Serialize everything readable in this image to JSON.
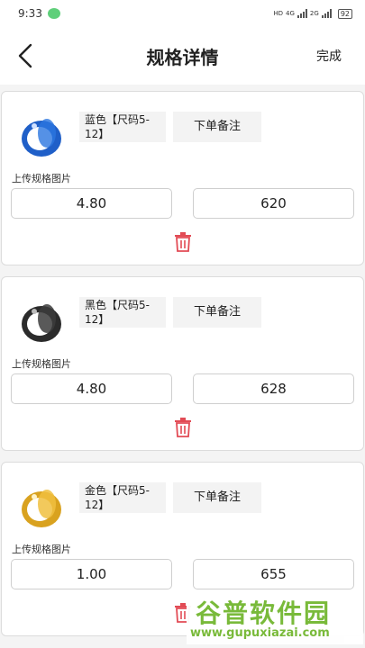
{
  "status_bar": {
    "time": "9:33",
    "net_left": "HD",
    "net_4g": "4G",
    "net_2g": "2G",
    "battery": "92"
  },
  "header": {
    "title": "规格详情",
    "done_label": "完成"
  },
  "items": [
    {
      "spec_name": "蓝色【尺码5-12】",
      "note_label": "下单备注",
      "upload_label": "上传规格图片",
      "price": "4.80",
      "stock": "620",
      "ring_color": "#1f5fc8",
      "ring_icon": "blue-ring-image"
    },
    {
      "spec_name": "黑色【尺码5-12】",
      "note_label": "下单备注",
      "upload_label": "上传规格图片",
      "price": "4.80",
      "stock": "628",
      "ring_color": "#2b2b2b",
      "ring_icon": "black-ring-image"
    },
    {
      "spec_name": "金色【尺码5-12】",
      "note_label": "下单备注",
      "upload_label": "上传规格图片",
      "price": "1.00",
      "stock": "655",
      "ring_color": "#d9a21f",
      "ring_icon": "gold-ring-image"
    }
  ],
  "colors": {
    "trash": "#e24b55",
    "watermark": "#74b832"
  },
  "watermark": {
    "line1": "谷普软件园",
    "line2": "www.gupuxiazai.com"
  }
}
